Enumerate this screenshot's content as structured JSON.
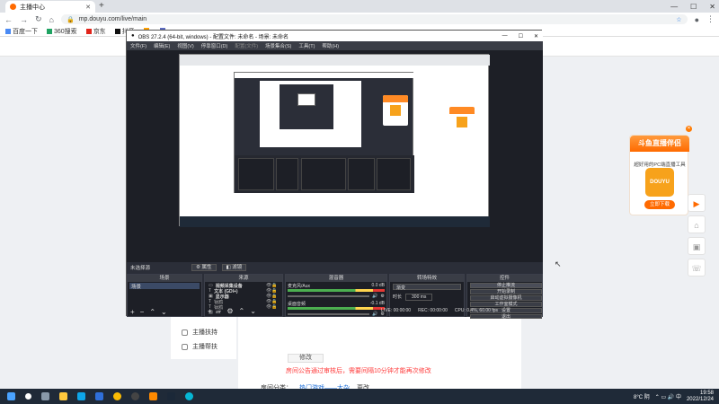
{
  "browser": {
    "tab_title": "主播中心",
    "url": "mp.douyu.com/live/main",
    "bookmarks": [
      "百度一下",
      "360搜索",
      "京东",
      "抖音",
      "",
      "",
      ""
    ]
  },
  "page": {
    "left_nav": [
      "主播扶持",
      "主播帮扶"
    ],
    "modify_button": "修改",
    "notice": "房间公告通过审核后，需要间隔10分钟才能再次修改",
    "link_label": "房间分类：",
    "link_text": "热门游戏——大杂",
    "link_extra": "更改"
  },
  "promo": {
    "title": "斗鱼直播伴侣",
    "subtitle": "超好用的PC端直播工具",
    "logo_text": "DOUYU",
    "button": "立即下载"
  },
  "obs": {
    "title": "OBS 27.2.4 (64-bit, windows) - 配置文件: 未命名 - 场景: 未命名",
    "menu": [
      "文件(F)",
      "编辑(E)",
      "视图(V)",
      "停靠窗口(D)",
      "配置(文件)",
      "场景集合(S)",
      "工具(T)",
      "帮助(H)"
    ],
    "status_label": "未选择源",
    "props_btn": "属性",
    "filters_btn": "滤镜",
    "docks": {
      "scenes": "场景",
      "sources": "来源",
      "mixer": "混音器",
      "transitions": "转场特效",
      "controls": "控件"
    },
    "scene_item": "场景",
    "sources": [
      {
        "name": "视频采集设备",
        "extra": ""
      },
      {
        "name": "文本 (GDI+)",
        "extra": ""
      },
      {
        "name": "显示器",
        "extra": ""
      },
      {
        "name": "钛鸥",
        "extra": ""
      },
      {
        "name": "钛鸥",
        "extra": ""
      },
      {
        "name": "aa",
        "extra": ""
      }
    ],
    "mixer": [
      {
        "name": "桌面音频",
        "db": "-0.1 dB"
      },
      {
        "name": "麦克风/Aux",
        "db": "0.0 dB"
      }
    ],
    "transition": {
      "type": "渐变",
      "duration_label": "时长",
      "duration": "300 ms"
    },
    "controls": [
      "停止推流",
      "开始录制",
      "启动虚拟摄像机",
      "工作室模式",
      "设置",
      "退出"
    ],
    "stats": {
      "live": "LIVE: 00:00:00",
      "rec": "REC: 00:00:00",
      "cpu": "CPU: 0.4%, 60.00 fps"
    }
  },
  "taskbar": {
    "weather": "8°C 阴",
    "time": "19:58",
    "date": "2022/12/24"
  }
}
